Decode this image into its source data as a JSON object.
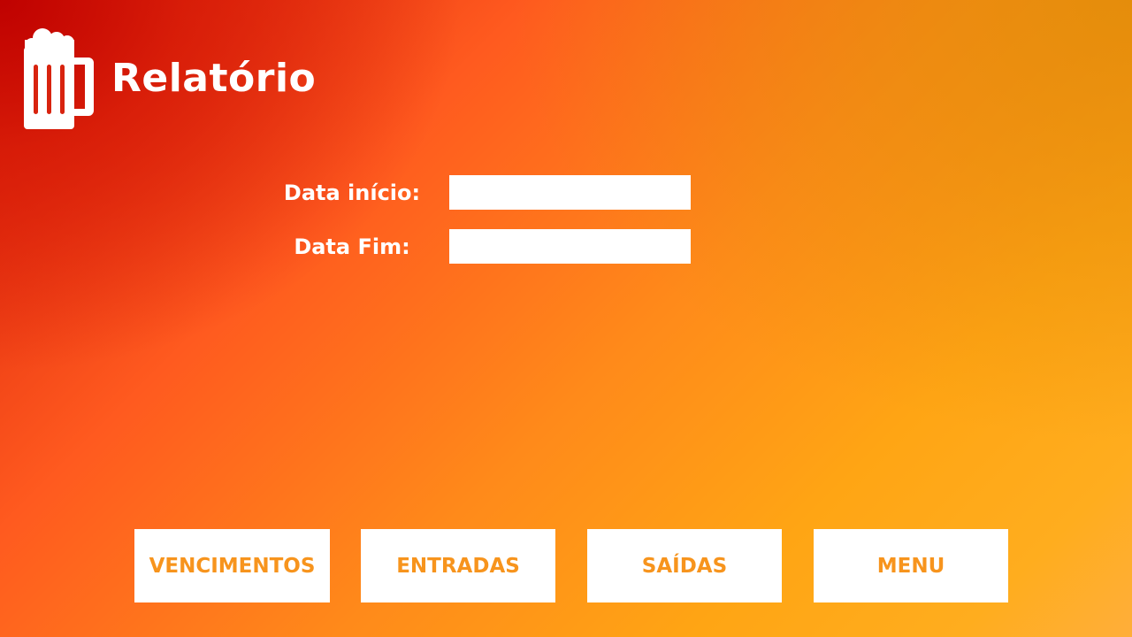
{
  "header": {
    "title": "Relatório",
    "icon": "beer-mug-icon"
  },
  "form": {
    "start_date": {
      "label": "Data início:",
      "value": "",
      "placeholder": ""
    },
    "end_date": {
      "label": "Data Fim:",
      "value": "",
      "placeholder": ""
    }
  },
  "nav": {
    "buttons": [
      {
        "label": "VENCIMENTOS"
      },
      {
        "label": "ENTRADAS"
      },
      {
        "label": "SAÍDAS"
      },
      {
        "label": "MENU"
      }
    ]
  },
  "colors": {
    "text_white": "#ffffff",
    "button_text": "#f7941d",
    "background_start": "#c40000",
    "background_mid": "#ff5a1f",
    "background_end": "#ffa514"
  }
}
